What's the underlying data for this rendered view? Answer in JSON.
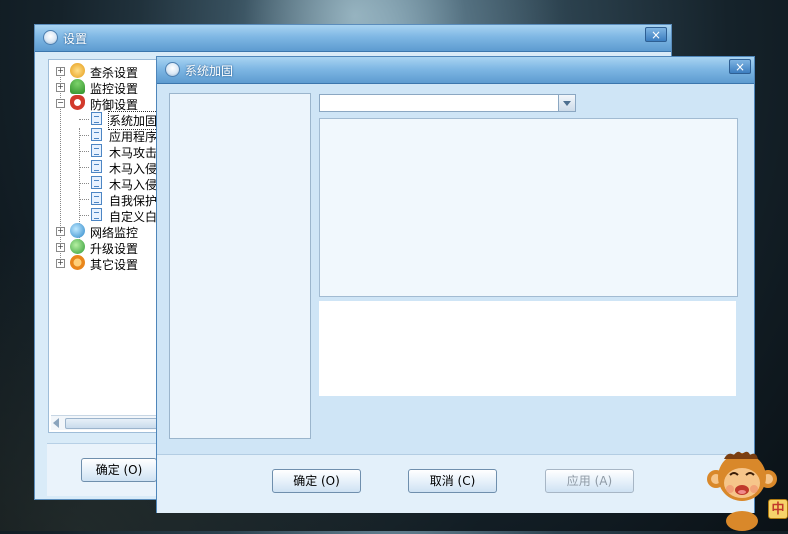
{
  "settings_window": {
    "title": "设置",
    "close_glyph": "×",
    "tree": [
      {
        "label": "查杀设置",
        "icon": "scan-settings-icon",
        "expander": "+"
      },
      {
        "label": "监控设置",
        "icon": "monitor-settings-icon",
        "expander": "+"
      },
      {
        "label": "防御设置",
        "icon": "shield-icon",
        "expander": "−"
      },
      {
        "label": "系统加固",
        "icon": "doc-icon",
        "selected": true
      },
      {
        "label": "应用程序",
        "icon": "doc-icon"
      },
      {
        "label": "木马攻击",
        "icon": "doc-icon"
      },
      {
        "label": "木马入侵",
        "icon": "doc-icon"
      },
      {
        "label": "木马入侵",
        "icon": "doc-icon"
      },
      {
        "label": "自我保护",
        "icon": "doc-icon"
      },
      {
        "label": "自定义白",
        "icon": "doc-icon"
      },
      {
        "label": "网络监控",
        "icon": "network-icon",
        "expander": "+"
      },
      {
        "label": "升级设置",
        "icon": "upgrade-icon",
        "expander": "+"
      },
      {
        "label": "其它设置",
        "icon": "other-settings-icon",
        "expander": "+"
      }
    ],
    "ok_button": "确定 (O)"
  },
  "hardening_window": {
    "title": "系统加固",
    "close_glyph": "×",
    "dropdown_value": "",
    "buttons": {
      "ok": "确定 (O)",
      "cancel": "取消 (C)",
      "apply": "应用 (A)"
    }
  },
  "mascot": {
    "badge": "中"
  },
  "colors": {
    "titlebar": "#7fb7e4",
    "window_bg": "#d9ebf8",
    "accent_border": "#4f86ba"
  }
}
